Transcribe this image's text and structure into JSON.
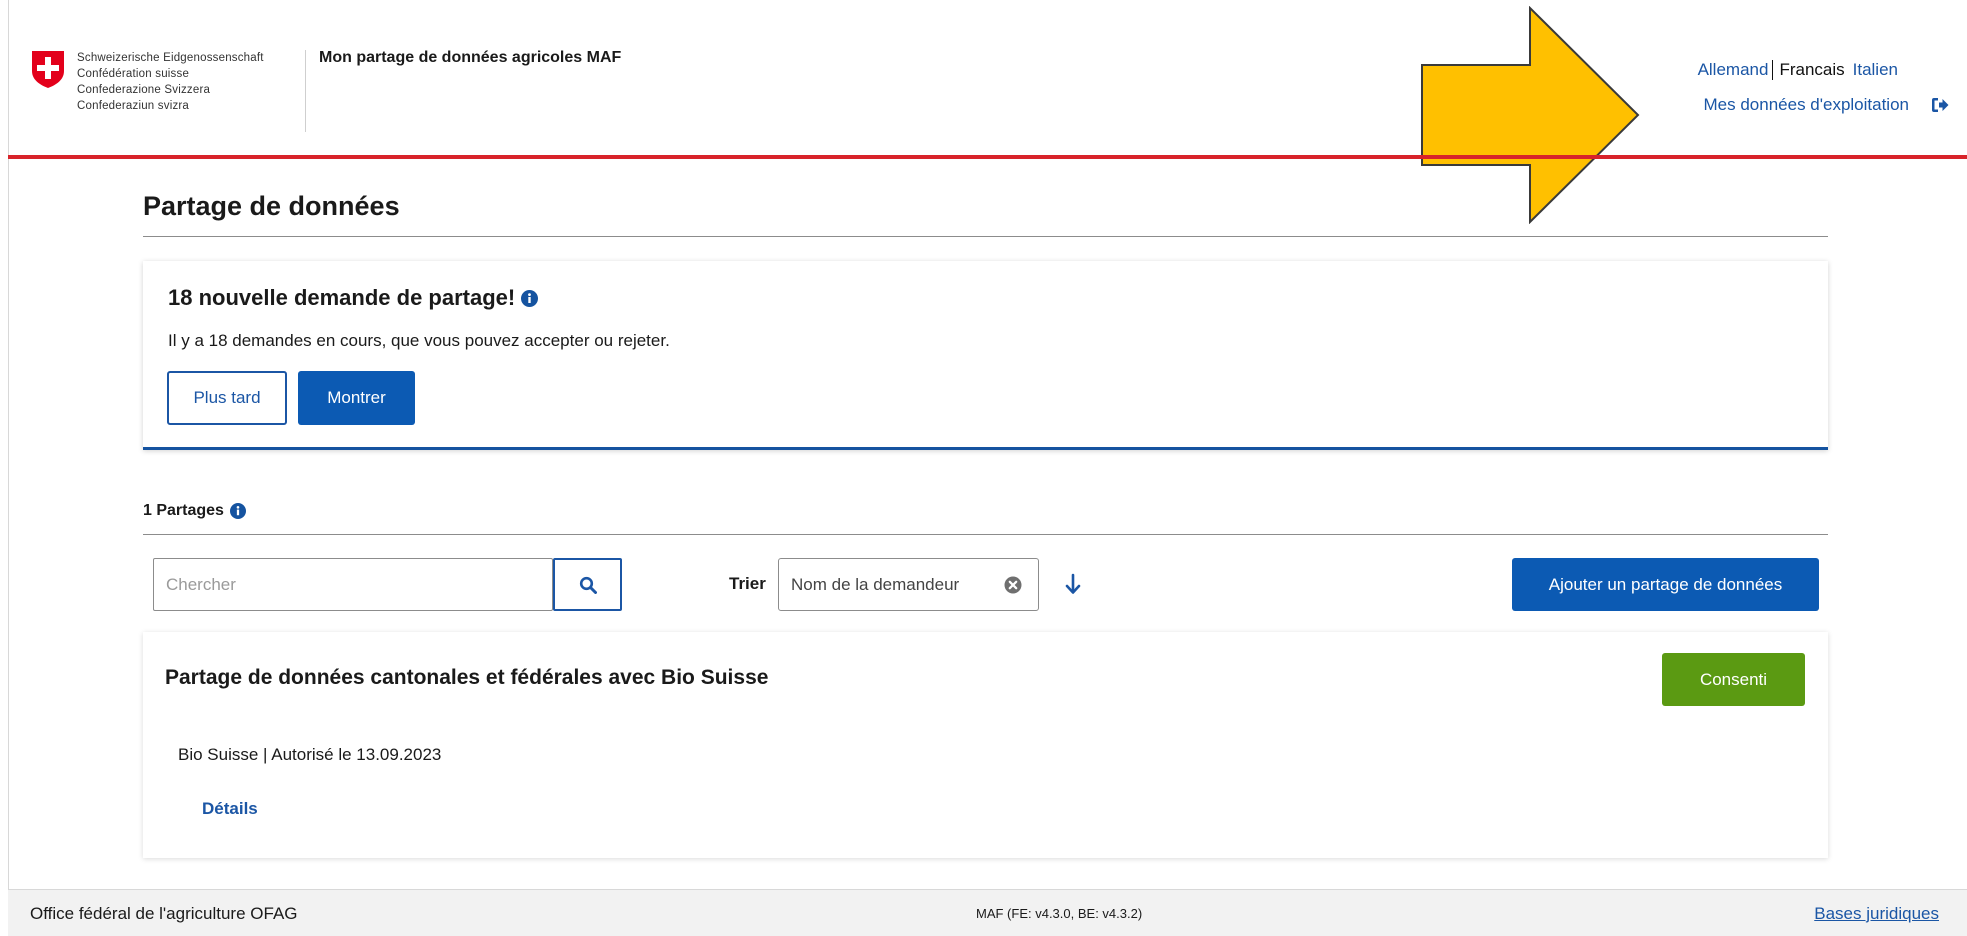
{
  "header": {
    "confederation_lines": [
      "Schweizerische Eidgenossenschaft",
      "Confédération suisse",
      "Confederazione Svizzera",
      "Confederaziun svizra"
    ],
    "app_title": "Mon partage de données agricoles MAF",
    "languages": [
      "Allemand",
      "Francais",
      "Italien"
    ],
    "active_language": "Francais",
    "account_link": "Mes données d'exploitation",
    "accent_color": "#d8232a"
  },
  "main": {
    "page_title": "Partage de données",
    "notice": {
      "title": "18 nouvelle demande de partage!",
      "text": "Il y a 18 demandes en cours, que vous pouvez accepter ou rejeter.",
      "later_button": "Plus tard",
      "show_button": "Montrer"
    },
    "shares_count_label": "1 Partages",
    "search": {
      "placeholder": "Chercher"
    },
    "sort": {
      "label": "Trier",
      "value": "Nom de la demandeur"
    },
    "add_button": "Ajouter un partage de données",
    "shares": [
      {
        "title": "Partage de données cantonales et fédérales avec Bio Suisse",
        "status": "Consenti",
        "meta": "Bio Suisse | Autorisé le 13.09.2023",
        "details_link": "Détails"
      }
    ]
  },
  "footer": {
    "org": "Office fédéral de l'agriculture OFAG",
    "version": "MAF (FE: v4.3.0, BE: v4.3.2)",
    "legal_link": "Bases juridiques"
  },
  "colors": {
    "primary": "#0c5ab3",
    "link": "#1b56a5",
    "success": "#5b9a12",
    "annotation_arrow": "#ffc000"
  }
}
